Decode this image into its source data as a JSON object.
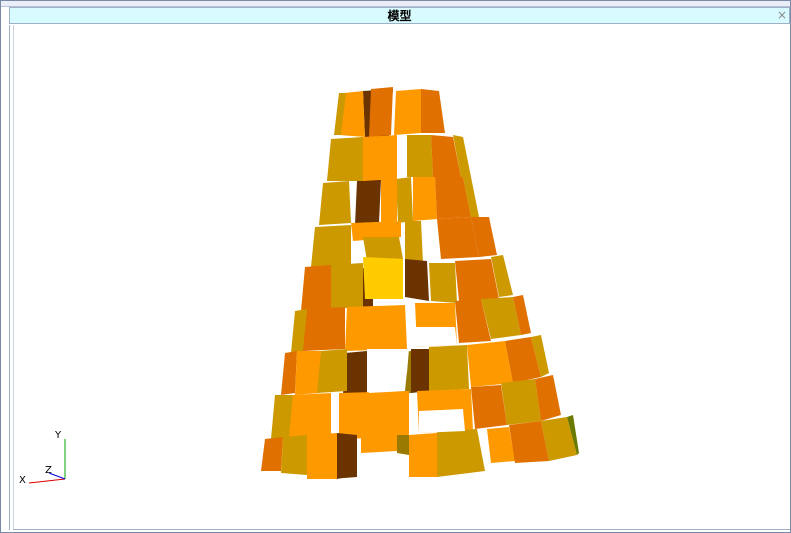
{
  "window": {
    "title": "模型",
    "close_glyph": "×"
  },
  "viewport": {
    "model_description": "3D tower model",
    "colors": {
      "orange": "#ff9900",
      "dark_orange": "#e07000",
      "olive": "#cc9900",
      "brown": "#6b3300",
      "highlight": "#ffcc00",
      "olive_dark": "#9a7a00"
    }
  },
  "axes": {
    "x_label": "X",
    "y_label": "Y",
    "z_label": "Z",
    "x_color": "#dd0000",
    "y_color": "#00aa00",
    "z_color": "#0000dd"
  }
}
